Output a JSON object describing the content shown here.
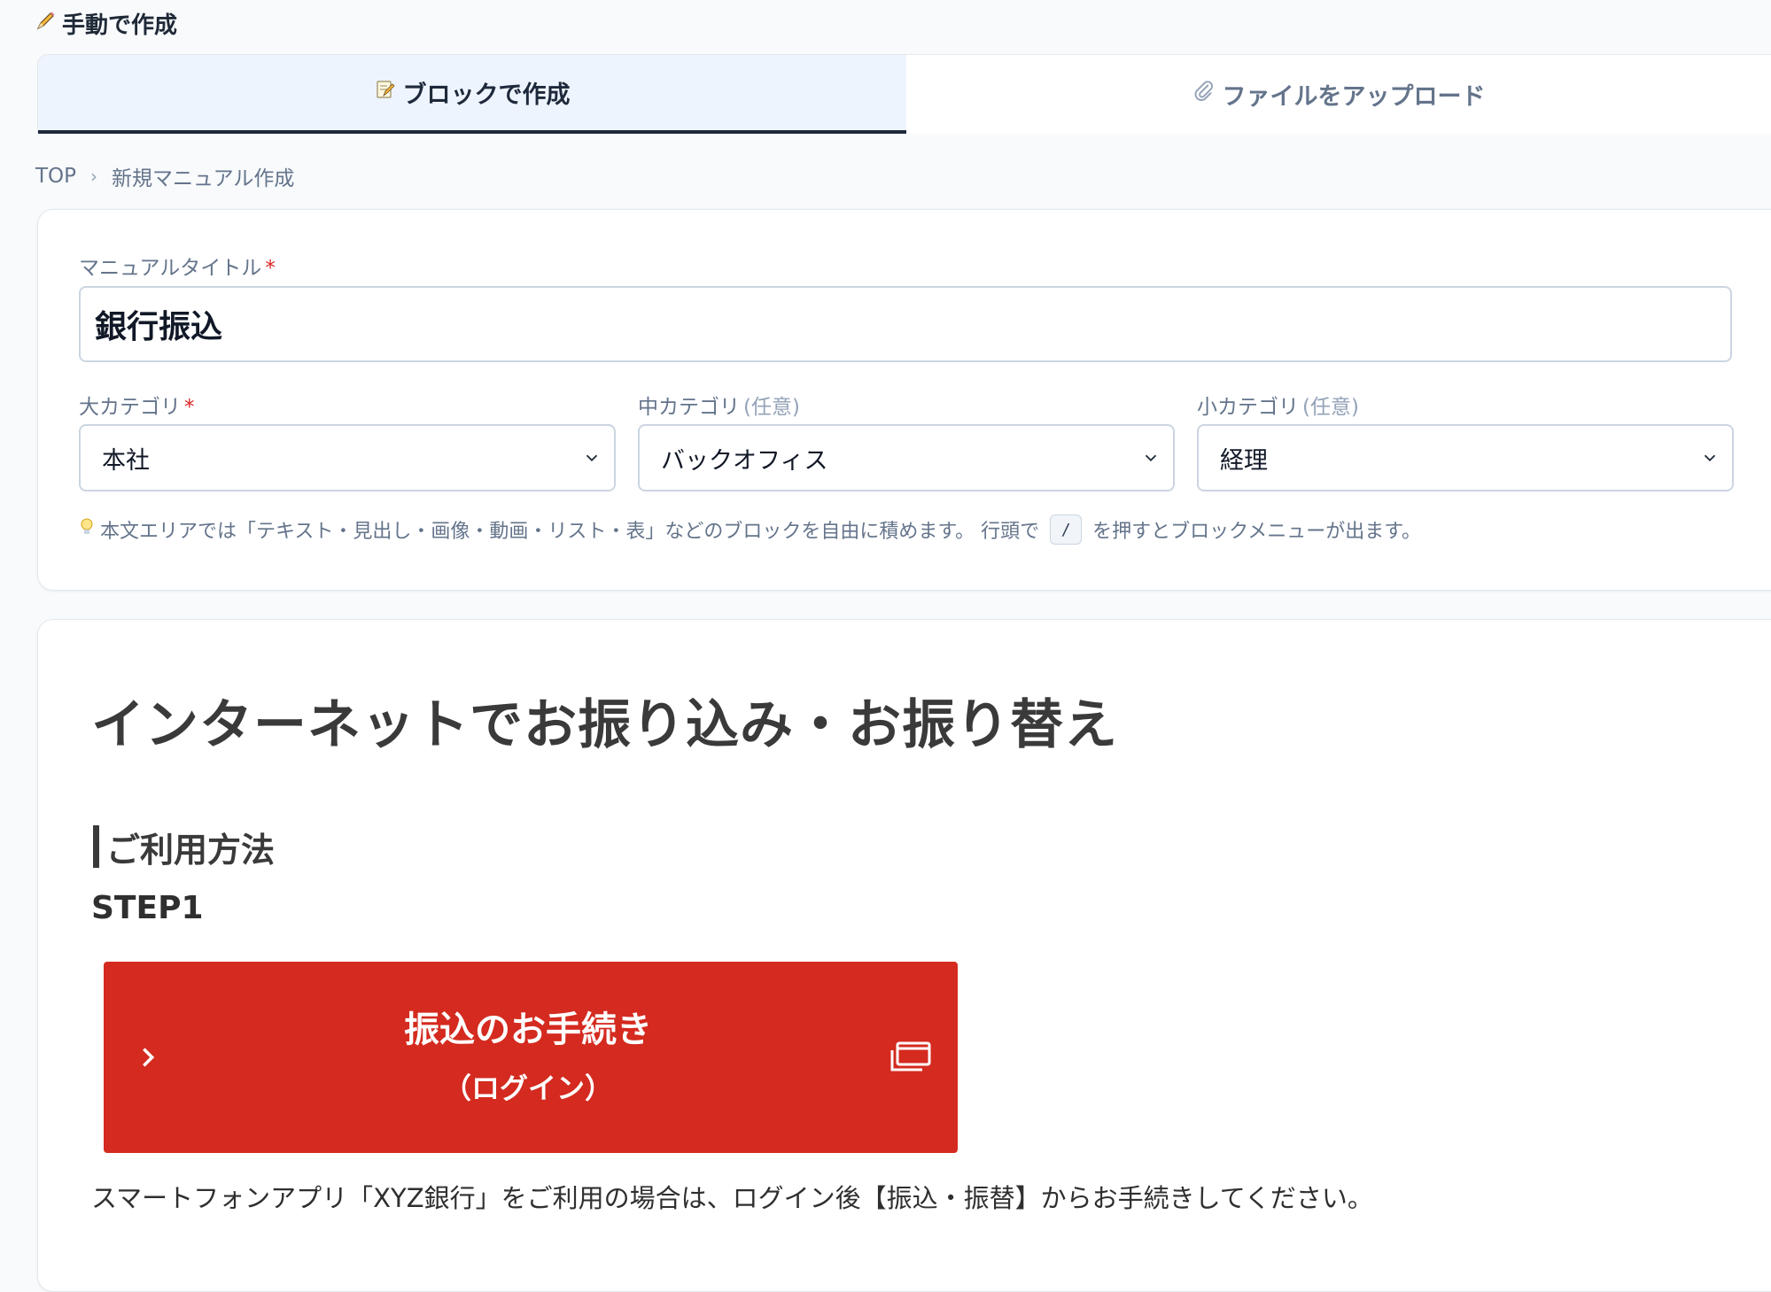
{
  "page": {
    "heading_icon": "pencil-icon",
    "heading": "手動で作成"
  },
  "tabs": [
    {
      "icon": "memo-icon",
      "label": "ブロックで作成",
      "active": true
    },
    {
      "icon": "paperclip-icon",
      "label": "ファイルをアップロード",
      "active": false
    }
  ],
  "breadcrumb": {
    "items": [
      "TOP",
      "新規マニュアル作成"
    ],
    "separator": "›"
  },
  "form": {
    "title_label": "マニュアルタイトル",
    "required_mark": "*",
    "title_value": "銀行振込",
    "major_category_label": "大カテゴリ",
    "major_category_value": "本社",
    "middle_category_label": "中カテゴリ",
    "middle_category_optional": "(任意)",
    "middle_category_value": "バックオフィス",
    "minor_category_label": "小カテゴリ",
    "minor_category_optional": "(任意)",
    "minor_category_value": "経理",
    "hint_icon": "lightbulb-icon",
    "hint_text": "本文エリアでは「テキスト・見出し・画像・動画・リスト・表」などのブロックを自由に積めます。 行頭で",
    "hint_key": "/",
    "hint_text_after": "を押すとブロックメニューが出ます。"
  },
  "editor": {
    "title": "インターネットでお振り込み・お振り替え",
    "section_heading": "ご利用方法",
    "step_label": "STEP1",
    "cta_main": "振込のお手続き",
    "cta_sub": "（ログイン）",
    "cta_icons": [
      "chevron-right-icon",
      "new-window-icon"
    ],
    "paragraph": "スマートフォンアプリ「XYZ銀行」をご利用の場合は、ログイン後【振込・振替】からお手続きしてください。"
  },
  "colors": {
    "accent_dark": "#1e293b",
    "tab_active_bg": "#eef4fd",
    "cta_red": "#d42a1f",
    "required_red": "#dc2626",
    "muted_text": "#64748b"
  }
}
